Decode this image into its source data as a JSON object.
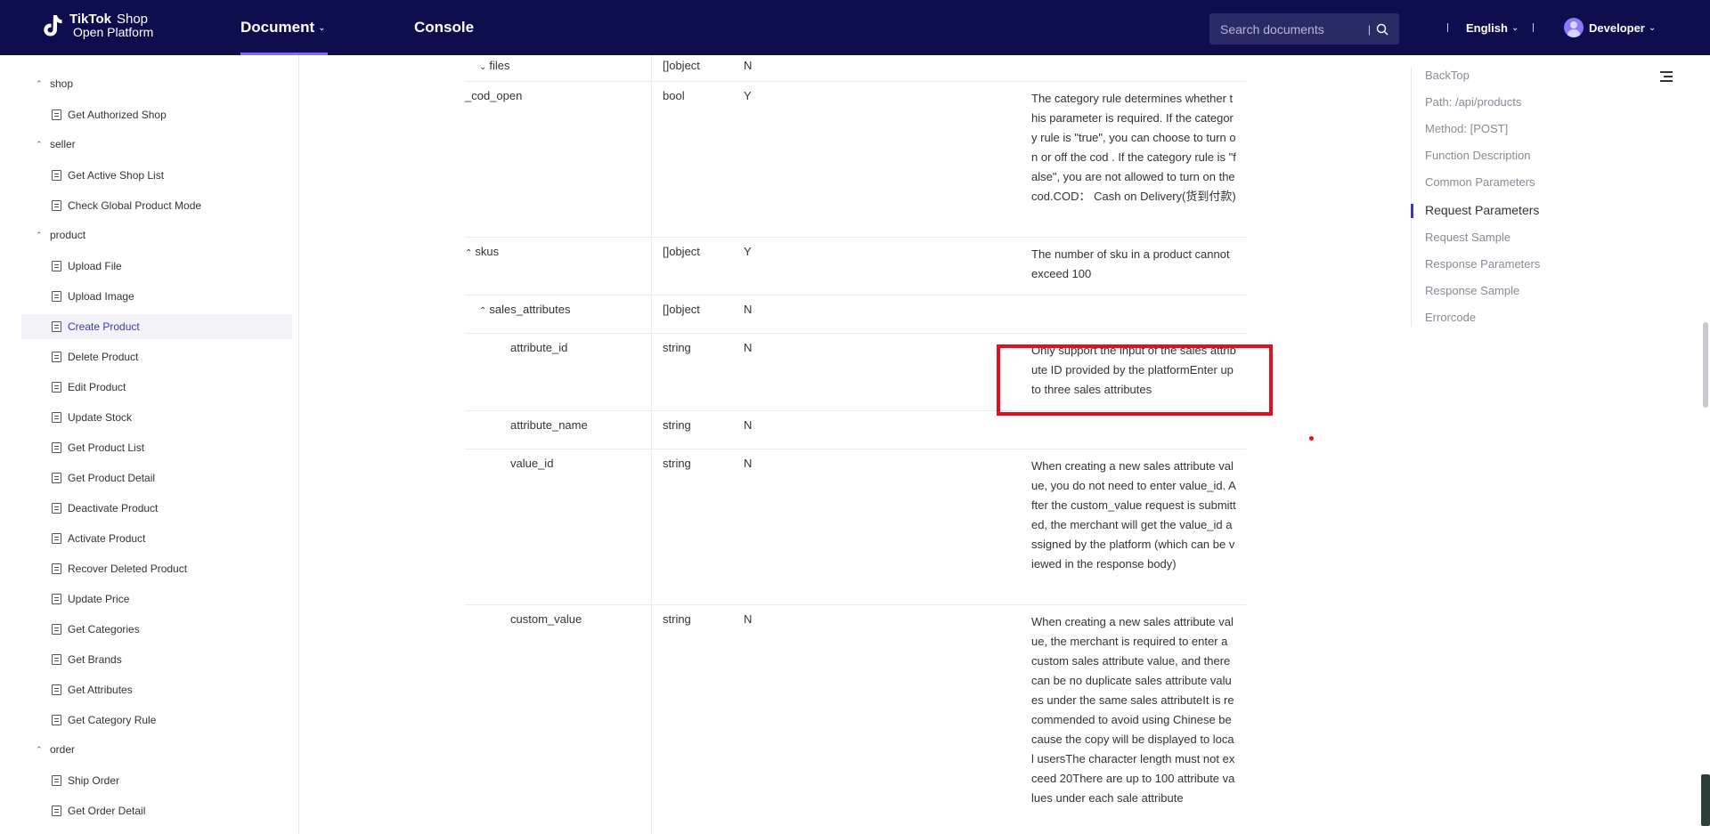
{
  "header": {
    "logo_brand": "TikTok",
    "logo_shop": "Shop",
    "logo_sub": "Open Platform",
    "nav_document": "Document",
    "nav_console": "Console",
    "search_placeholder": "Search documents",
    "language": "English",
    "user": "Developer"
  },
  "sidebar": {
    "groups": [
      {
        "label": "shop",
        "items": [
          "Get Authorized Shop"
        ]
      },
      {
        "label": "seller",
        "items": [
          "Get Active Shop List",
          "Check Global Product Mode"
        ]
      },
      {
        "label": "product",
        "items": [
          "Upload File",
          "Upload Image",
          "Create Product",
          "Delete Product",
          "Edit Product",
          "Update Stock",
          "Get Product List",
          "Get Product Detail",
          "Deactivate Product",
          "Activate Product",
          "Recover Deleted Product",
          "Update Price",
          "Get Categories",
          "Get Brands",
          "Get Attributes",
          "Get Category Rule"
        ]
      },
      {
        "label": "order",
        "items": [
          "Ship Order",
          "Get Order Detail"
        ]
      }
    ],
    "active_item": "Create Product"
  },
  "table": {
    "rows": [
      {
        "name": "files",
        "toggle": "v",
        "type": "[]object",
        "req": "N",
        "desc": ""
      },
      {
        "name": "_cod_open",
        "toggle": "",
        "type": "bool",
        "req": "Y",
        "desc": "The category rule determines whether this parameter is required. If the category rule is \"true\", you can choose to turn on or off the cod . If the category rule is \"false\", you are not allowed to turn on the cod.COD： Cash on Delivery(货到付款)"
      },
      {
        "name": "skus",
        "toggle": "^",
        "type": "[]object",
        "req": "Y",
        "desc": "The number of sku in a product cannot exceed 100"
      },
      {
        "name": "sales_attributes",
        "toggle": "^",
        "type": "[]object",
        "req": "N",
        "desc": ""
      },
      {
        "name": "attribute_id",
        "toggle": "",
        "type": "string",
        "req": "N",
        "desc": "Only support the input of the sales attribute ID provided by the platformEnter up to three sales attributes"
      },
      {
        "name": "attribute_name",
        "toggle": "",
        "type": "string",
        "req": "N",
        "desc": ""
      },
      {
        "name": "value_id",
        "toggle": "",
        "type": "string",
        "req": "N",
        "desc": "When creating a new sales attribute value, you do not need to enter value_id. After the custom_value request is submitted, the merchant will get the value_id assigned by the platform (which can be viewed in the response body)"
      },
      {
        "name": "custom_value",
        "toggle": "",
        "type": "string",
        "req": "N",
        "desc": "When creating a new sales attribute value, the merchant is required to enter a custom sales attribute value, and there can be no duplicate sales attribute values under the same sales attributeIt is recommended to avoid using Chinese because the copy will be displayed to local usersThe character length must not exceed 20There are up to 100 attribute values under each sale attribute"
      }
    ]
  },
  "toc": {
    "items": [
      "BackTop",
      "Path: /api/products",
      "Method: [POST]",
      "Function Description",
      "Common Parameters",
      "Request Parameters",
      "Request Sample",
      "Response Parameters",
      "Response Sample",
      "Errorcode"
    ],
    "active": "Request Parameters"
  }
}
